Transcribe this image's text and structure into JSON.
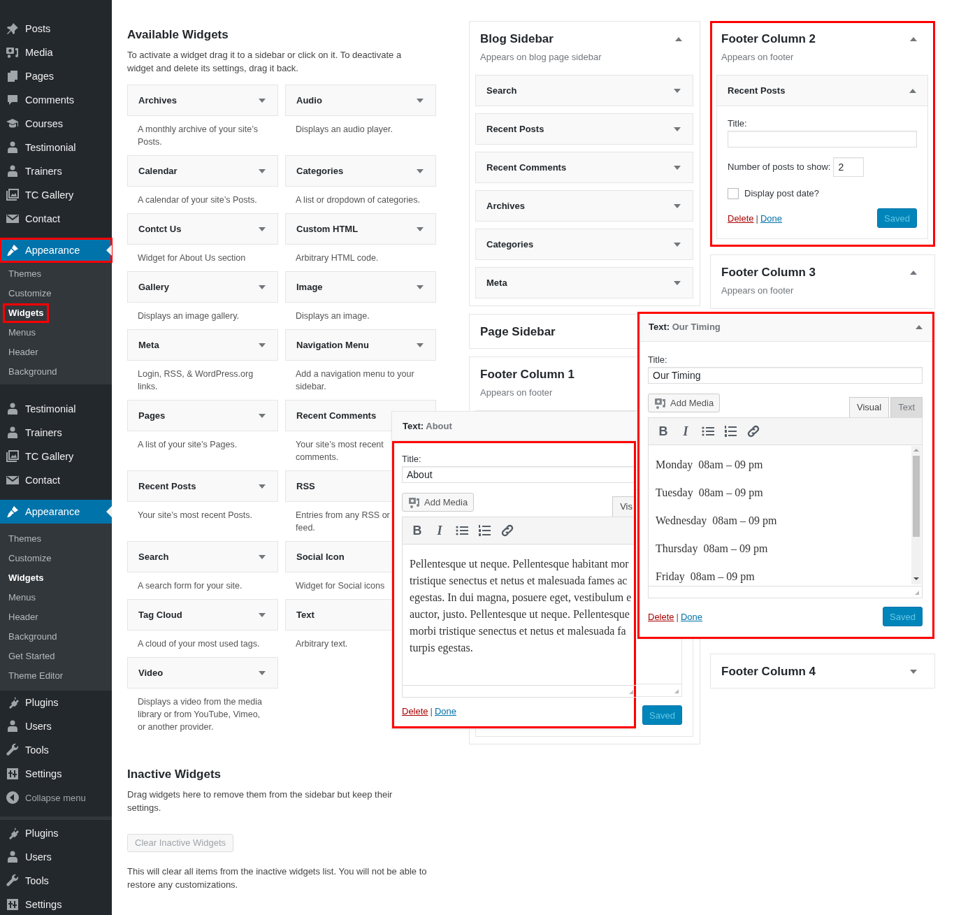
{
  "sidebar": {
    "groups": [
      {
        "kind": "menu",
        "items": [
          {
            "label": "Posts",
            "selected": false,
            "highlighted": false
          },
          {
            "label": "Media",
            "selected": false,
            "highlighted": false
          },
          {
            "label": "Pages",
            "selected": false,
            "highlighted": false
          },
          {
            "label": "Comments",
            "selected": false,
            "highlighted": false
          },
          {
            "label": "Courses",
            "selected": false,
            "highlighted": false
          },
          {
            "label": "Testimonial",
            "selected": false,
            "highlighted": false
          },
          {
            "label": "Trainers",
            "selected": false,
            "highlighted": false
          },
          {
            "label": "TC Gallery",
            "selected": false,
            "highlighted": false
          },
          {
            "label": "Contact",
            "selected": false,
            "highlighted": false
          },
          {
            "label": "Appearance",
            "selected": true,
            "highlighted": true
          }
        ]
      },
      {
        "kind": "flyout",
        "items": [
          {
            "label": "Themes",
            "selected": false,
            "highlighted": false
          },
          {
            "label": "Customize",
            "selected": false,
            "highlighted": false
          },
          {
            "label": "Widgets",
            "selected": true,
            "highlighted": true
          },
          {
            "label": "Menus",
            "selected": false,
            "highlighted": false
          },
          {
            "label": "Header",
            "selected": false,
            "highlighted": false
          },
          {
            "label": "Background",
            "selected": false,
            "highlighted": false
          }
        ]
      },
      {
        "kind": "menu",
        "items": [
          {
            "label": "Testimonial",
            "selected": false
          },
          {
            "label": "Trainers",
            "selected": false
          },
          {
            "label": "TC Gallery",
            "selected": false
          },
          {
            "label": "Contact",
            "selected": false
          },
          {
            "label": "Appearance",
            "selected": true
          }
        ]
      },
      {
        "kind": "submenu",
        "items": [
          {
            "label": "Themes",
            "selected": false
          },
          {
            "label": "Customize",
            "selected": false
          },
          {
            "label": "Widgets",
            "selected": true
          },
          {
            "label": "Menus",
            "selected": false
          },
          {
            "label": "Header",
            "selected": false
          },
          {
            "label": "Background",
            "selected": false
          },
          {
            "label": "Get Started",
            "selected": false
          },
          {
            "label": "Theme Editor",
            "selected": false
          }
        ]
      },
      {
        "kind": "menu",
        "items": [
          {
            "label": "Plugins",
            "selected": false
          },
          {
            "label": "Users",
            "selected": false
          },
          {
            "label": "Tools",
            "selected": false
          },
          {
            "label": "Settings",
            "selected": false
          }
        ]
      },
      {
        "kind": "collapse",
        "items": [
          {
            "label": "Collapse menu"
          }
        ]
      },
      {
        "kind": "menu",
        "items": [
          {
            "label": "Plugins",
            "selected": false
          },
          {
            "label": "Users",
            "selected": false
          },
          {
            "label": "Tools",
            "selected": false
          },
          {
            "label": "Settings",
            "selected": false
          }
        ]
      }
    ]
  },
  "available_widgets": {
    "heading": "Available Widgets",
    "description": "To activate a widget drag it to a sidebar or click on it. To deactivate a widget and delete its settings, drag it back.",
    "widgets": [
      {
        "name": "Archives",
        "description": "A monthly archive of your site’s Posts."
      },
      {
        "name": "Audio",
        "description": "Displays an audio player."
      },
      {
        "name": "Calendar",
        "description": "A calendar of your site’s Posts."
      },
      {
        "name": "Categories",
        "description": "A list or dropdown of categories."
      },
      {
        "name": "Contct Us",
        "description": "Widget for About Us section"
      },
      {
        "name": "Custom HTML",
        "description": "Arbitrary HTML code."
      },
      {
        "name": "Gallery",
        "description": "Displays an image gallery."
      },
      {
        "name": "Image",
        "description": "Displays an image."
      },
      {
        "name": "Meta",
        "description": "Login, RSS, & WordPress.org links."
      },
      {
        "name": "Navigation Menu",
        "description": "Add a navigation menu to your sidebar."
      },
      {
        "name": "Pages",
        "description": "A list of your site’s Pages."
      },
      {
        "name": "Recent Comments",
        "description": "Your site’s most recent comments."
      },
      {
        "name": "Recent Posts",
        "description": "Your site’s most recent Posts."
      },
      {
        "name": "RSS",
        "description": "Entries from any RSS or\nfeed."
      },
      {
        "name": "Search",
        "description": "A search form for your site."
      },
      {
        "name": "Social Icon",
        "description": "Widget for Social icons"
      },
      {
        "name": "Tag Cloud",
        "description": "A cloud of your most used tags."
      },
      {
        "name": "Text",
        "description": "Arbitrary text."
      },
      {
        "name": "Video",
        "description": "Displays a video from the media library or from YouTube, Vimeo, or another provider."
      }
    ]
  },
  "inactive_widgets": {
    "heading": "Inactive Widgets",
    "description": "Drag widgets here to remove them from the sidebar but keep their settings.",
    "button": "Clear Inactive Widgets",
    "button_disabled": true,
    "note": "This will clear all items from the inactive widgets list. You will not be able to restore any customizations."
  },
  "widget_area_columns": [
    {
      "areas": [
        {
          "title": "Blog Sidebar",
          "description": "Appears on blog page sidebar",
          "expanded": true,
          "highlighted": false,
          "widgets": [
            {
              "kind": "collapsed",
              "name": "Search"
            },
            {
              "kind": "collapsed",
              "name": "Recent Posts"
            },
            {
              "kind": "collapsed",
              "name": "Recent Comments"
            },
            {
              "kind": "collapsed",
              "name": "Archives"
            },
            {
              "kind": "collapsed",
              "name": "Categories"
            },
            {
              "kind": "collapsed",
              "name": "Meta"
            }
          ]
        },
        {
          "title": "Page Sidebar",
          "expanded": false,
          "highlighted": false
        },
        {
          "title": "Footer Column 1",
          "description": "Appears on footer",
          "expanded": true,
          "highlighted": false,
          "widgets": [
            {
              "kind": "text_form",
              "save": "Saved"
            }
          ]
        }
      ]
    },
    {
      "areas": [
        {
          "title": "Footer Column 2",
          "description": "Appears on footer",
          "expanded": true,
          "highlighted": true,
          "widgets": [
            {
              "kind": "recent_posts",
              "name": "Recent Posts",
              "title_label": "Title:",
              "count_label": "Number of posts to show:",
              "count_value": "2",
              "date_label": "Display post date?",
              "date_checked": false,
              "delete": "Delete",
              "separator": "|",
              "done": "Done",
              "save": "Saved"
            }
          ]
        },
        {
          "title": "Footer Column 3",
          "description": "Appears on footer",
          "expanded": true,
          "highlighted": false
        },
        {
          "title": "Footer Column 4",
          "expanded": false,
          "highlighted": false
        }
      ]
    }
  ],
  "open_widget_forms": [
    {
      "prefix": "Text:",
      "title": "About",
      "highlighted": false,
      "body_highlighted": true,
      "title_label": "Title:",
      "title_value": "About",
      "add_media": "Add Media",
      "tabs": [
        {
          "label": "Vis",
          "selected": true
        }
      ],
      "toolbar_buttons": [
        "B",
        "I"
      ],
      "paragraphs": [
        "Pellentesque ut neque. Pellentesque habitant mor\ntristique senectus et netus et malesuada fames ac\negestas. In dui magna, posuere eget, vestibulum e\nauctor, justo. Pellentesque ut neque. Pellentesque\nmorbi tristique senectus et netus et malesuada fa\nturpis egestas."
      ],
      "delete": "Delete",
      "separator": "|",
      "done": "Done"
    },
    {
      "prefix": "Text:",
      "title": "Our Timing",
      "expanded": true,
      "highlighted": true,
      "body_highlighted": false,
      "title_label": "Title:",
      "title_value": "Our Timing",
      "add_media": "Add Media",
      "tabs": [
        {
          "label": "Visual",
          "selected": true
        },
        {
          "label": "Text",
          "selected": false
        }
      ],
      "toolbar_buttons": [
        "B",
        "I"
      ],
      "paragraphs": [
        "Monday  08am – 09 pm",
        "Tuesday  08am – 09 pm",
        "Wednesday  08am – 09 pm",
        "Thursday  08am – 09 pm",
        "Friday  08am – 09 pm"
      ],
      "delete": "Delete",
      "separator": "|",
      "done": "Done",
      "save": "Saved"
    }
  ]
}
